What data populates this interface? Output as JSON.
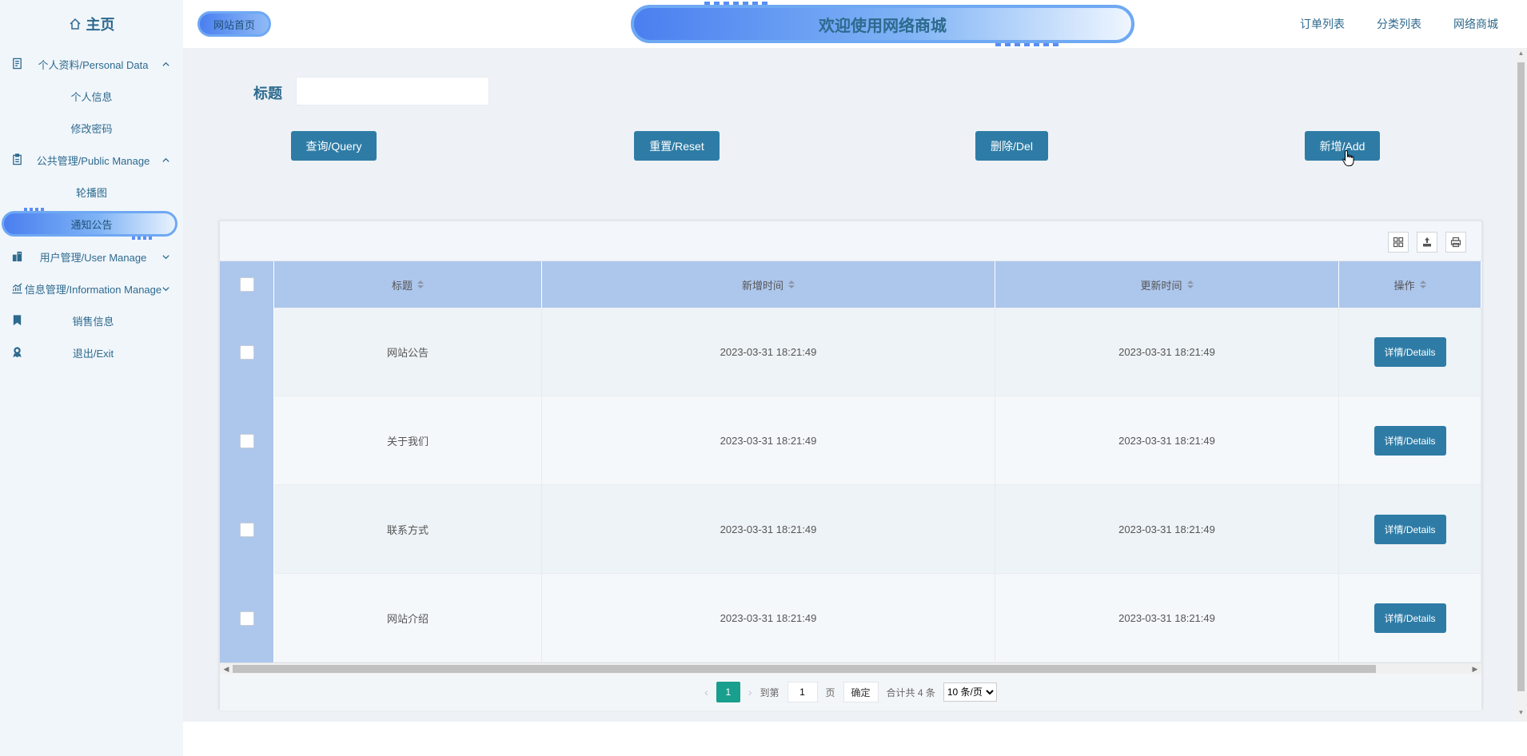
{
  "sidebar": {
    "home_label": "主页",
    "groups": [
      {
        "label": "个人资料/Personal Data",
        "icon": "document-icon",
        "expanded": true,
        "items": [
          "个人信息",
          "修改密码"
        ]
      },
      {
        "label": "公共管理/Public Manage",
        "icon": "clipboard-icon",
        "expanded": true,
        "items": [
          "轮播图",
          "通知公告"
        ]
      },
      {
        "label": "用户管理/User Manage",
        "icon": "building-icon",
        "expanded": false
      },
      {
        "label": "信息管理/Information Manage",
        "icon": "chart-icon",
        "expanded": false
      }
    ],
    "single_items": [
      {
        "label": "销售信息",
        "icon": "bookmark-icon"
      },
      {
        "label": "退出/Exit",
        "icon": "user-badge-icon"
      }
    ],
    "active_item": "通知公告"
  },
  "header": {
    "home_badge": "网站首页",
    "banner_title": "欢迎使用网络商城",
    "nav": [
      "订单列表",
      "分类列表",
      "网络商城"
    ]
  },
  "search": {
    "label": "标题",
    "value": ""
  },
  "actions": {
    "query": "查询/Query",
    "reset": "重置/Reset",
    "delete": "删除/Del",
    "add": "新增/Add"
  },
  "table": {
    "columns": [
      "标题",
      "新增时间",
      "更新时间",
      "操作"
    ],
    "rows": [
      {
        "title": "网站公告",
        "created": "2023-03-31 18:21:49",
        "updated": "2023-03-31 18:21:49",
        "action": "详情/Details"
      },
      {
        "title": "关于我们",
        "created": "2023-03-31 18:21:49",
        "updated": "2023-03-31 18:21:49",
        "action": "详情/Details"
      },
      {
        "title": "联系方式",
        "created": "2023-03-31 18:21:49",
        "updated": "2023-03-31 18:21:49",
        "action": "详情/Details"
      },
      {
        "title": "网站介绍",
        "created": "2023-03-31 18:21:49",
        "updated": "2023-03-31 18:21:49",
        "action": "详情/Details"
      }
    ]
  },
  "pagination": {
    "current": "1",
    "goto_label": "到第",
    "goto_value": "1",
    "page_suffix": "页",
    "confirm": "确定",
    "total": "合计共 4 条",
    "page_size": "10 条/页"
  },
  "colors": {
    "primary": "#2e7ca6",
    "header_row": "#adc6ec",
    "pager_active": "#199f8d",
    "text_accent": "#2d6a8e"
  }
}
